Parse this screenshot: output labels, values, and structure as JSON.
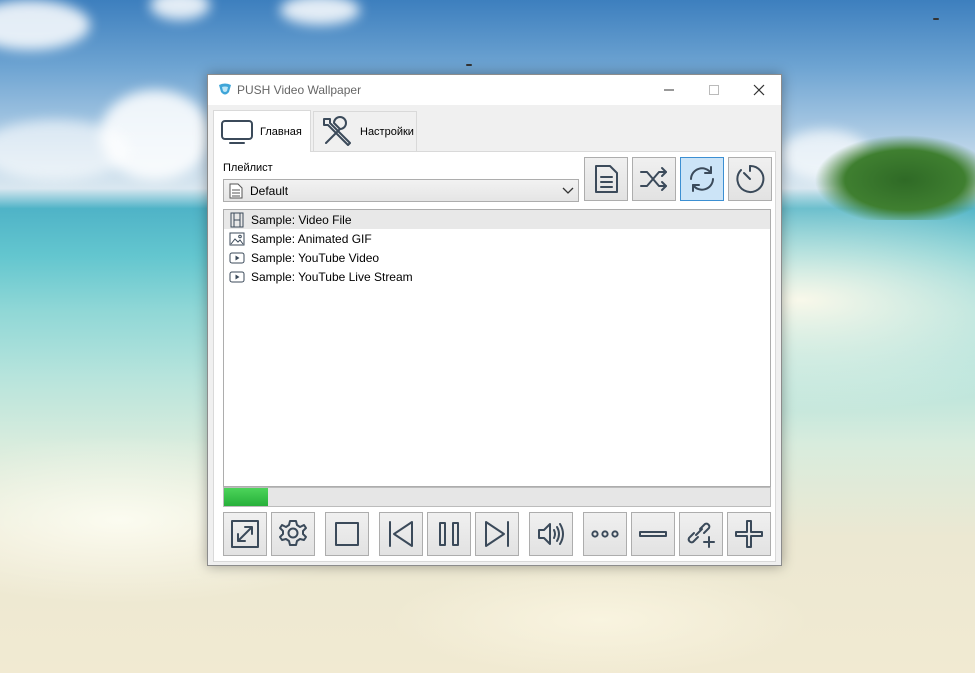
{
  "window": {
    "title": "PUSH Video Wallpaper"
  },
  "tabs": [
    {
      "label": "Главная",
      "icon": "monitor-icon",
      "active": true
    },
    {
      "label": "Настройки",
      "icon": "tools-icon",
      "active": false
    }
  ],
  "playlist": {
    "label": "Плейлист",
    "selected": "Default"
  },
  "toolbar_top": [
    {
      "name": "playlist-file-button",
      "icon": "document-icon"
    },
    {
      "name": "shuffle-button",
      "icon": "shuffle-icon"
    },
    {
      "name": "repeat-button",
      "icon": "repeat-icon",
      "active": true
    },
    {
      "name": "timer-button",
      "icon": "timer-icon"
    }
  ],
  "items": [
    {
      "label": "Sample: Video File",
      "icon": "film-icon",
      "selected": true
    },
    {
      "label": "Sample: Animated GIF",
      "icon": "image-icon",
      "selected": false
    },
    {
      "label": "Sample: YouTube Video",
      "icon": "youtube-icon",
      "selected": false
    },
    {
      "label": "Sample: YouTube Live Stream",
      "icon": "youtube-icon",
      "selected": false
    }
  ],
  "progress": {
    "fraction": 0.08,
    "color": "#2fbf44"
  },
  "toolbar_bottom": [
    {
      "name": "fullscreen-button",
      "icon": "expand-icon"
    },
    {
      "name": "settings-button",
      "icon": "gear-icon"
    },
    {
      "name": "stop-button",
      "icon": "stop-icon"
    },
    {
      "name": "previous-button",
      "icon": "skip-back-icon"
    },
    {
      "name": "pause-button",
      "icon": "pause-icon"
    },
    {
      "name": "next-button",
      "icon": "skip-forward-icon"
    },
    {
      "name": "volume-button",
      "icon": "volume-icon"
    },
    {
      "name": "more-button",
      "icon": "ellipsis-icon"
    },
    {
      "name": "remove-button",
      "icon": "minus-icon"
    },
    {
      "name": "add-url-button",
      "icon": "link-add-icon"
    },
    {
      "name": "add-file-button",
      "icon": "plus-icon"
    }
  ]
}
